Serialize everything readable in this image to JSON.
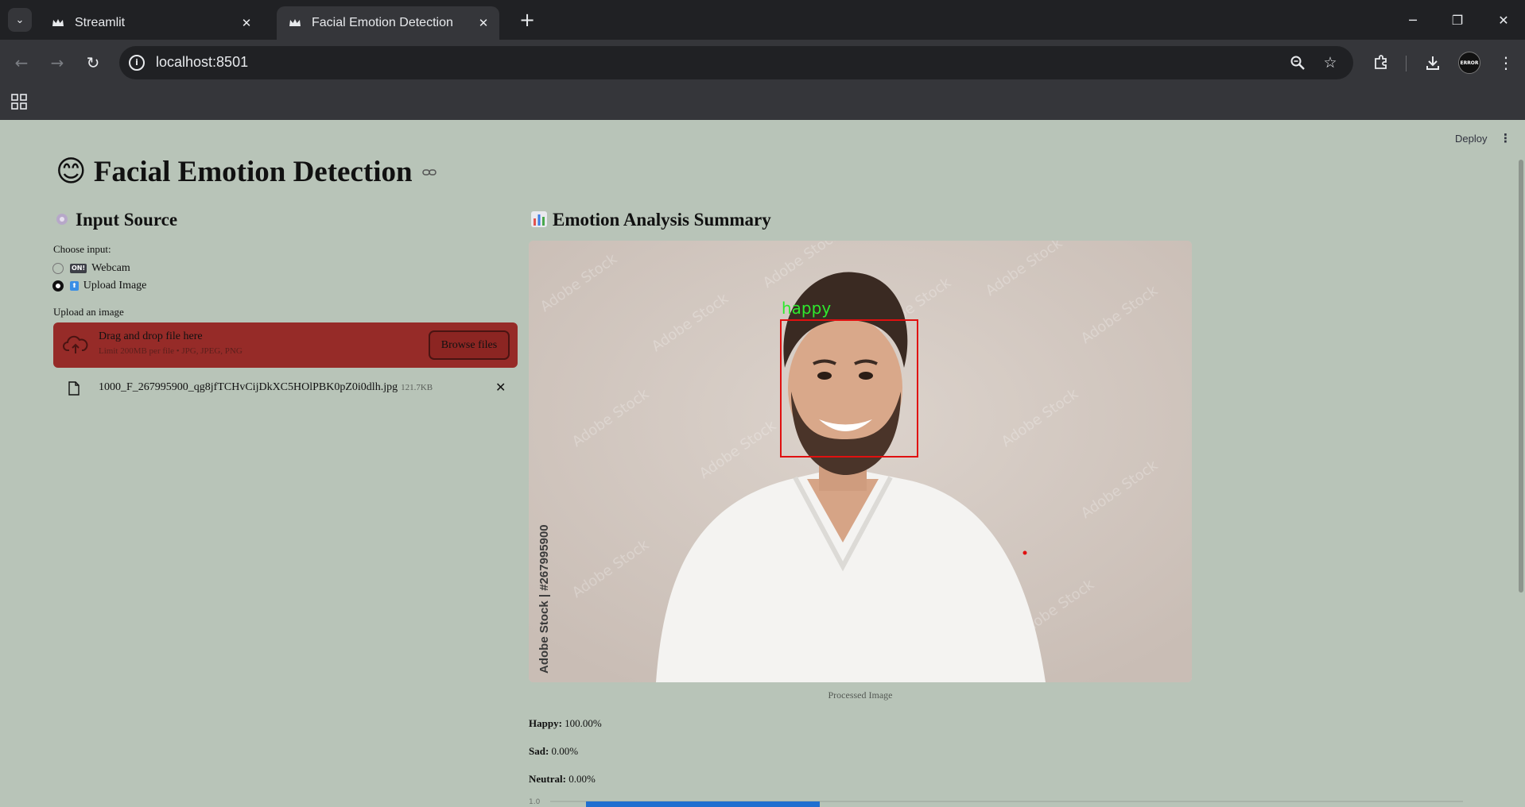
{
  "browser": {
    "tabs": [
      {
        "title": "Streamlit",
        "active": false
      },
      {
        "title": "Facial Emotion Detection",
        "active": true
      }
    ],
    "url": "localhost:8501"
  },
  "app": {
    "deploy_label": "Deploy",
    "title": "Facial Emotion Detection",
    "title_emoji": "😊",
    "input_section": {
      "heading": "Input Source",
      "choose_label": "Choose input:",
      "options": [
        {
          "label": "Webcam",
          "badge": "ON!",
          "selected": false
        },
        {
          "label": "Upload Image",
          "badge": "⬆",
          "selected": true
        }
      ],
      "upload_label": "Upload an image",
      "dropzone_title": "Drag and drop file here",
      "dropzone_limit": "Limit 200MB per file • JPG, JPEG, PNG",
      "browse_label": "Browse files",
      "file": {
        "name": "1000_F_267995900_qg8jfTCHvCijDkXC5HOlPBK0pZ0i0dlh.jpg",
        "size": "121.7KB"
      }
    },
    "summary_section": {
      "heading": "Emotion Analysis Summary",
      "image": {
        "detected_label": "happy",
        "watermark": "Adobe Stock",
        "stock_id": "Adobe Stock | #267995900"
      },
      "caption": "Processed Image",
      "stats": [
        {
          "label": "Happy:",
          "value": "100.00%"
        },
        {
          "label": "Sad:",
          "value": "0.00%"
        },
        {
          "label": "Neutral:",
          "value": "0.00%"
        }
      ],
      "chart_axis_label": "1.0"
    }
  },
  "colors": {
    "app_background": "#b8c4b8",
    "dropzone": "#962b28",
    "detection_box": "#e01010",
    "detection_label": "#2ee82e",
    "chart_bar": "#1f6fd0"
  }
}
